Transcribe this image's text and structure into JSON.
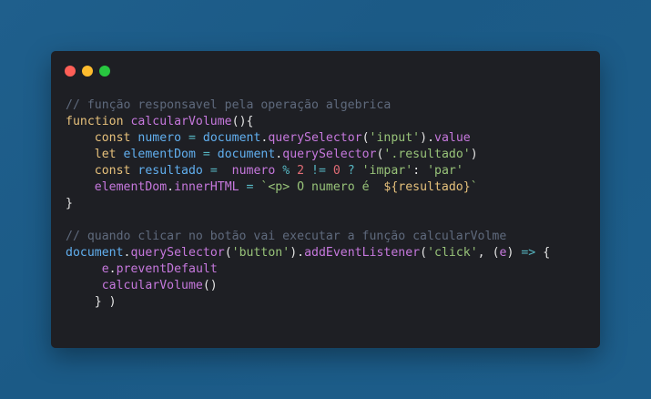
{
  "colors": {
    "background": "#1f5f8c",
    "window": "#1e1f24",
    "traffic_red": "#ff5f57",
    "traffic_yellow": "#febc2e",
    "traffic_green": "#28c840"
  },
  "code": {
    "lines": [
      {
        "tokens": [
          {
            "type": "comment",
            "text": "// função responsavel pela operação algebrica"
          }
        ]
      },
      {
        "tokens": [
          {
            "type": "keyword",
            "text": "function "
          },
          {
            "type": "func",
            "text": "calcularVolume"
          },
          {
            "type": "paren",
            "text": "(){"
          }
        ]
      },
      {
        "tokens": [
          {
            "type": "plain",
            "text": "    "
          },
          {
            "type": "keyword",
            "text": "const "
          },
          {
            "type": "var",
            "text": "numero "
          },
          {
            "type": "op",
            "text": "= "
          },
          {
            "type": "ident",
            "text": "document"
          },
          {
            "type": "punct",
            "text": "."
          },
          {
            "type": "prop",
            "text": "querySelector"
          },
          {
            "type": "paren",
            "text": "("
          },
          {
            "type": "string",
            "text": "'input'"
          },
          {
            "type": "paren",
            "text": ")"
          },
          {
            "type": "punct",
            "text": "."
          },
          {
            "type": "prop",
            "text": "value"
          }
        ]
      },
      {
        "tokens": [
          {
            "type": "plain",
            "text": "    "
          },
          {
            "type": "keyword",
            "text": "let "
          },
          {
            "type": "var",
            "text": "elementDom "
          },
          {
            "type": "op",
            "text": "= "
          },
          {
            "type": "ident",
            "text": "document"
          },
          {
            "type": "punct",
            "text": "."
          },
          {
            "type": "prop",
            "text": "querySelector"
          },
          {
            "type": "paren",
            "text": "("
          },
          {
            "type": "string",
            "text": "'.resultado'"
          },
          {
            "type": "paren",
            "text": ")"
          }
        ]
      },
      {
        "tokens": [
          {
            "type": "plain",
            "text": "    "
          },
          {
            "type": "keyword",
            "text": "const "
          },
          {
            "type": "var",
            "text": "resultado "
          },
          {
            "type": "op",
            "text": "=  "
          },
          {
            "type": "func",
            "text": "numero "
          },
          {
            "type": "op",
            "text": "% "
          },
          {
            "type": "number",
            "text": "2 "
          },
          {
            "type": "op",
            "text": "!= "
          },
          {
            "type": "number",
            "text": "0 "
          },
          {
            "type": "op",
            "text": "? "
          },
          {
            "type": "string",
            "text": "'impar'"
          },
          {
            "type": "punct",
            "text": ": "
          },
          {
            "type": "string",
            "text": "'par'"
          }
        ]
      },
      {
        "tokens": [
          {
            "type": "plain",
            "text": "    "
          },
          {
            "type": "func",
            "text": "elementDom"
          },
          {
            "type": "punct",
            "text": "."
          },
          {
            "type": "prop",
            "text": "innerHTML "
          },
          {
            "type": "op",
            "text": "= "
          },
          {
            "type": "template",
            "text": "`<p> O numero é  "
          },
          {
            "type": "templateVar",
            "text": "${resultado}"
          },
          {
            "type": "template",
            "text": "`"
          }
        ]
      },
      {
        "tokens": [
          {
            "type": "brace",
            "text": "}"
          }
        ]
      },
      {
        "tokens": [
          {
            "type": "plain",
            "text": ""
          }
        ]
      },
      {
        "tokens": [
          {
            "type": "comment",
            "text": "// quando clicar no botão vai executar a função calcularVolme"
          }
        ]
      },
      {
        "tokens": [
          {
            "type": "ident",
            "text": "document"
          },
          {
            "type": "punct",
            "text": "."
          },
          {
            "type": "prop",
            "text": "querySelector"
          },
          {
            "type": "paren",
            "text": "("
          },
          {
            "type": "string",
            "text": "'button'"
          },
          {
            "type": "paren",
            "text": ")"
          },
          {
            "type": "punct",
            "text": "."
          },
          {
            "type": "prop",
            "text": "addEventListener"
          },
          {
            "type": "paren",
            "text": "("
          },
          {
            "type": "string",
            "text": "'click'"
          },
          {
            "type": "punct",
            "text": ", "
          },
          {
            "type": "paren",
            "text": "("
          },
          {
            "type": "func",
            "text": "e"
          },
          {
            "type": "paren",
            "text": ") "
          },
          {
            "type": "op",
            "text": "=> "
          },
          {
            "type": "paren",
            "text": "{"
          }
        ]
      },
      {
        "tokens": [
          {
            "type": "plain",
            "text": "     "
          },
          {
            "type": "func",
            "text": "e"
          },
          {
            "type": "punct",
            "text": "."
          },
          {
            "type": "prop",
            "text": "preventDefault"
          }
        ]
      },
      {
        "tokens": [
          {
            "type": "plain",
            "text": "     "
          },
          {
            "type": "prop",
            "text": "calcularVolume"
          },
          {
            "type": "paren",
            "text": "()"
          }
        ]
      },
      {
        "tokens": [
          {
            "type": "plain",
            "text": "    "
          },
          {
            "type": "paren",
            "text": "} )"
          }
        ]
      }
    ]
  }
}
